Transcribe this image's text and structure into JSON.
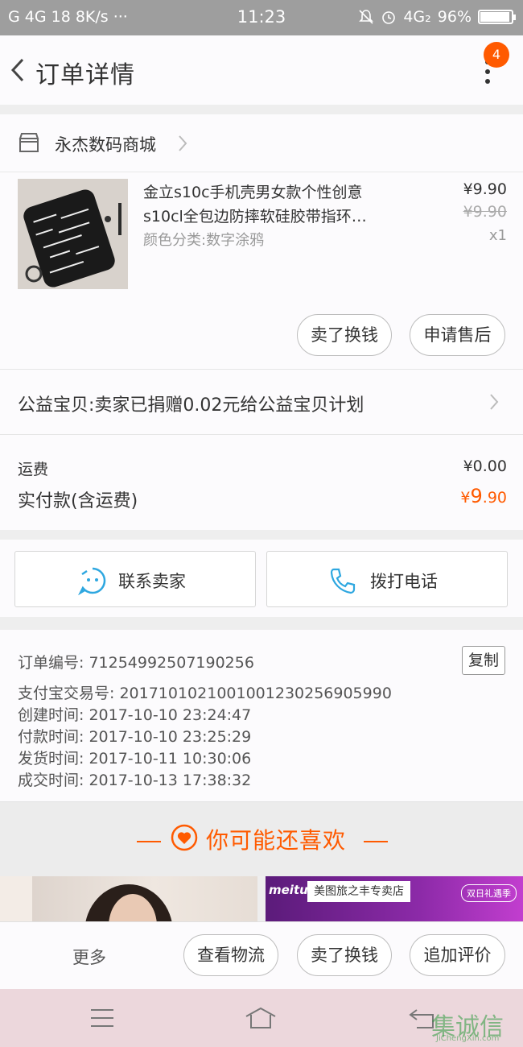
{
  "status_bar": {
    "left": "G 4G 18 8K/s ···",
    "time": "11:23",
    "network": "4G₂",
    "battery": "96%",
    "battery_level": 0.96
  },
  "header": {
    "title": "订单详情",
    "badge": "4"
  },
  "shop": {
    "name": "永杰数码商城"
  },
  "item": {
    "title_line1": "金立s10c手机壳男女款个性创意",
    "title_line2": "s10cl全包边防摔软硅胶带指环…",
    "sku": "颜色分类:数字涂鸦",
    "price": "¥9.90",
    "original_price": "¥9.90",
    "quantity": "x1",
    "btn_sell": "卖了换钱",
    "btn_aftersale": "申请售后"
  },
  "charity": {
    "text": "公益宝贝:卖家已捐赠0.02元给公益宝贝计划"
  },
  "totals": {
    "shipping_label": "运费",
    "shipping_value": "¥0.00",
    "paid_label": "实付款(含运费)",
    "paid_currency": "¥",
    "paid_int": "9",
    "paid_dec": ".90"
  },
  "contact": {
    "seller": "联系卖家",
    "phone": "拨打电话"
  },
  "order_info": {
    "order_no": "订单编号: 71254992507190256",
    "copy": "复制",
    "alipay_no": "支付宝交易号: 2017101021001001230256905990",
    "created": "创建时间: 2017-10-10  23:24:47",
    "paid": "付款时间: 2017-10-10  23:25:29",
    "shipped": "发货时间: 2017-10-11  10:30:06",
    "completed": "成交时间: 2017-10-13  17:38:32"
  },
  "recommend": {
    "title": "你可能还喜欢",
    "promo_logo": "meitu",
    "promo_shop": "美图旅之丰专卖店",
    "promo_tag": "双日礼遇季"
  },
  "bottom": {
    "more": "更多",
    "logistics": "查看物流",
    "sell": "卖了换钱",
    "review": "追加评价"
  },
  "watermark": {
    "cn": "集诚信",
    "en": "JiChengXin.com"
  },
  "colors": {
    "accent": "#ff5a00",
    "icon_blue": "#2ea7e0"
  }
}
